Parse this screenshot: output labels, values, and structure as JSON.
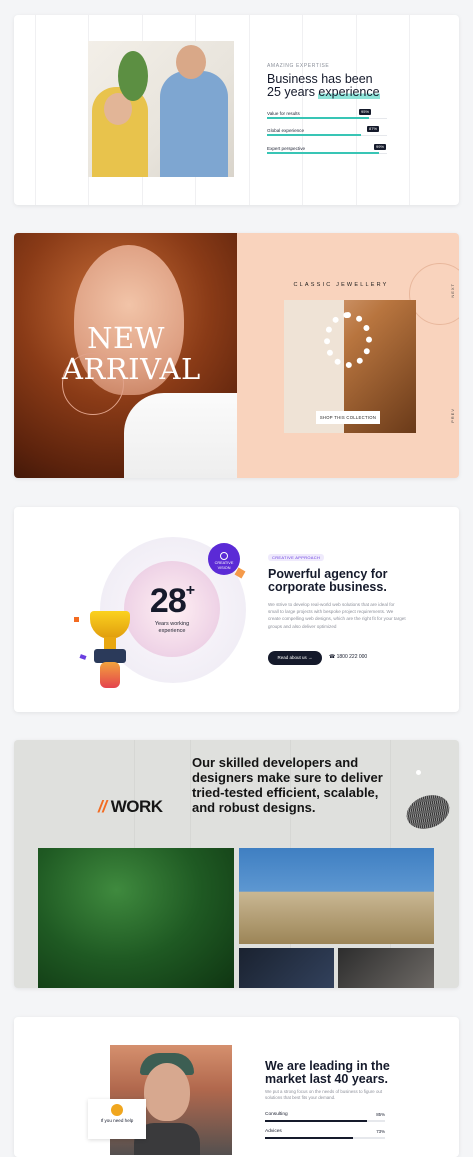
{
  "expertise": {
    "eyebrow": "AMAZING EXPERTISE",
    "title_line1": "Business has been",
    "title_line2a": "25 years ",
    "title_line2b": "experience",
    "bars": [
      {
        "label": "Value for results",
        "value": "95%",
        "fraction": 0.85
      },
      {
        "label": "Global experience",
        "value": "87%",
        "fraction": 0.78
      },
      {
        "label": "Expert perspective",
        "value": "99%",
        "fraction": 0.93
      }
    ],
    "accent": "#38c5b5"
  },
  "jewellery": {
    "headline_line1": "NEW",
    "headline_line2": "ARRIVAL",
    "collection_title": "CLASSIC JEWELLERY",
    "shop_button": "SHOP THIS COLLECTION",
    "next_label": "NEXT",
    "prev_label": "PREV",
    "background": "#f9d3bd"
  },
  "agency": {
    "years": "28",
    "years_suffix": "+",
    "years_caption_line1": "Years working",
    "years_caption_line2": "experience",
    "badge_line1": "CREATIVE",
    "badge_line2": "VISION",
    "chip": "CREATIVE APPROACH",
    "title_line1": "Powerful agency for",
    "title_line2": "corporate business.",
    "paragraph": "We strive to develop real-world web solutions that are ideal for small to large projects with bespoke project requirements. We create compelling web designs, which are the right fit for your target groups and also deliver optimized",
    "button": "Read about us",
    "phone": "1800 222 000",
    "accent": "#5b2ad6"
  },
  "work": {
    "slashes": "//",
    "label": "WORK",
    "headline": "Our skilled developers and designers make sure to deliver tried-tested efficient, scalable, and robust designs.",
    "accent": "#f36b21"
  },
  "leading": {
    "help_line1": "If you need help",
    "title": "We are leading in the market last 40 years.",
    "paragraph": "We put a strong focus on the needs of business to figure out solutions that best fits your demand.",
    "bars": [
      {
        "label": "Consulting",
        "value": "85%",
        "fraction": 0.85
      },
      {
        "label": "Advices",
        "value": "73%",
        "fraction": 0.73
      }
    ]
  }
}
